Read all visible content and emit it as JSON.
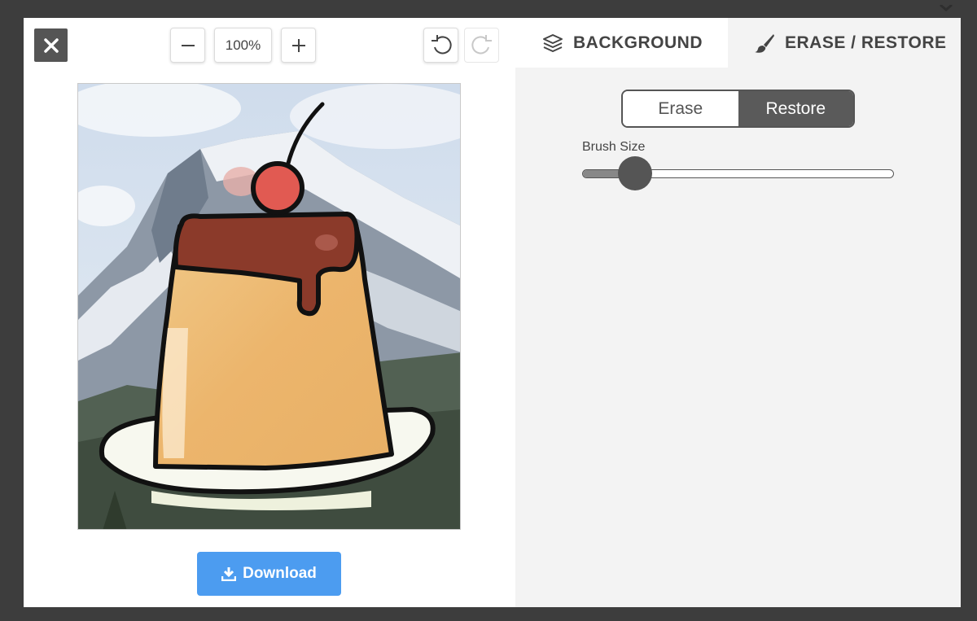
{
  "toolbar": {
    "zoom_level": "100%"
  },
  "actions": {
    "download_label": "Download"
  },
  "tabs": {
    "background_label": "BACKGROUND",
    "erase_restore_label": "ERASE / RESTORE"
  },
  "mode_toggle": {
    "erase_label": "Erase",
    "restore_label": "Restore",
    "selected": "Restore"
  },
  "brush": {
    "label": "Brush Size",
    "value_fraction": 0.17
  },
  "colors": {
    "accent_blue": "#4c9cf0",
    "dark_gray": "#555555",
    "panel_bg": "#f3f3f3"
  },
  "icons": {
    "close": "close-icon",
    "zoom_out": "minus-icon",
    "zoom_in": "plus-icon",
    "undo": "undo-icon",
    "redo": "redo-icon",
    "download": "download-icon",
    "layers": "layers-icon",
    "brush": "brush-icon"
  }
}
